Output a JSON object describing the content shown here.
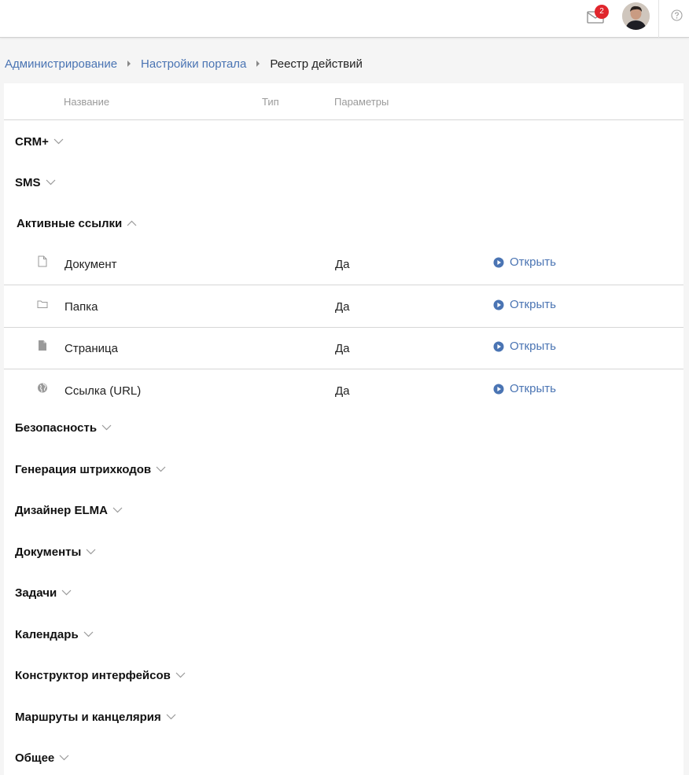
{
  "header": {
    "notifications_count": "2",
    "icons": [
      "mail-icon",
      "avatar",
      "help-icon"
    ]
  },
  "breadcrumb": [
    "Администрирование",
    "Настройки портала",
    "Реестр действий"
  ],
  "table": {
    "columns": [
      "Название",
      "Тип",
      "Параметры"
    ]
  },
  "groups_top": [
    {
      "label": "CRM+",
      "expanded": false
    },
    {
      "label": "SMS",
      "expanded": false
    },
    {
      "label": "Активные ссылки",
      "expanded": true
    }
  ],
  "active_links": [
    {
      "name": "Документ",
      "type": "Да",
      "action": "Открыть",
      "icon": "document-icon"
    },
    {
      "name": "Папка",
      "type": "Да",
      "action": "Открыть",
      "icon": "folder-icon"
    },
    {
      "name": "Страница",
      "type": "Да",
      "action": "Открыть",
      "icon": "page-icon"
    },
    {
      "name": "Ссылка (URL)",
      "type": "Да",
      "action": "Открыть",
      "icon": "globe-icon"
    }
  ],
  "groups_bottom": [
    {
      "label": "Безопасность",
      "expanded": false
    },
    {
      "label": "Генерация штрихкодов",
      "expanded": false
    },
    {
      "label": "Дизайнер ELMA",
      "expanded": false
    },
    {
      "label": "Документы",
      "expanded": false
    },
    {
      "label": "Задачи",
      "expanded": false
    },
    {
      "label": "Календарь",
      "expanded": false
    },
    {
      "label": "Конструктор интерфейсов",
      "expanded": false
    },
    {
      "label": "Маршруты и канцелярия",
      "expanded": false
    },
    {
      "label": "Общее",
      "expanded": false
    }
  ],
  "colors": {
    "link": "#4a74b3",
    "badge": "#e0262d",
    "border": "#d6d6d6"
  }
}
